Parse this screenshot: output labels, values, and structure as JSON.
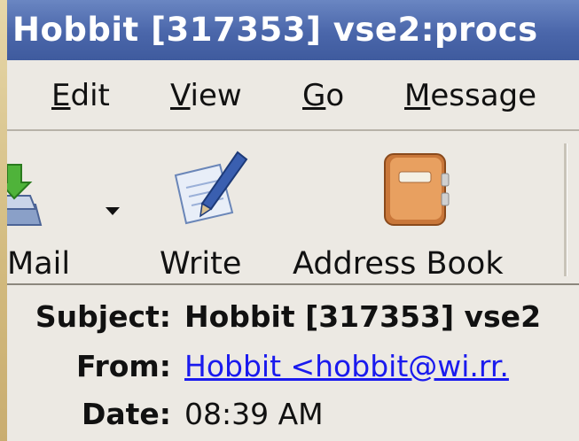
{
  "window": {
    "title": "Hobbit [317353] vse2:procs"
  },
  "menu": [
    {
      "label": "Edit",
      "mnemonic": "E",
      "rest": "dit"
    },
    {
      "label": "View",
      "mnemonic": "V",
      "rest": "iew"
    },
    {
      "label": "Go",
      "mnemonic": "G",
      "rest": "o"
    },
    {
      "label": "Message",
      "mnemonic": "M",
      "rest": "essage"
    }
  ],
  "toolbar": {
    "get_mail_label": "Mail",
    "write_label": "Write",
    "address_book_label": "Address Book"
  },
  "message_header": {
    "subject_label": "Subject:",
    "subject_value": "Hobbit [317353] vse2",
    "from_label": "From:",
    "from_value": "Hobbit <hobbit@wi.rr.",
    "date_label": "Date:",
    "date_value": "08:39 AM"
  },
  "colors": {
    "titlebar": "#4a66aa",
    "link": "#1a1aee",
    "window_bg": "#ece9e3"
  },
  "icons": [
    "get-mail-icon",
    "dropdown-arrow-icon",
    "write-icon",
    "address-book-icon"
  ]
}
